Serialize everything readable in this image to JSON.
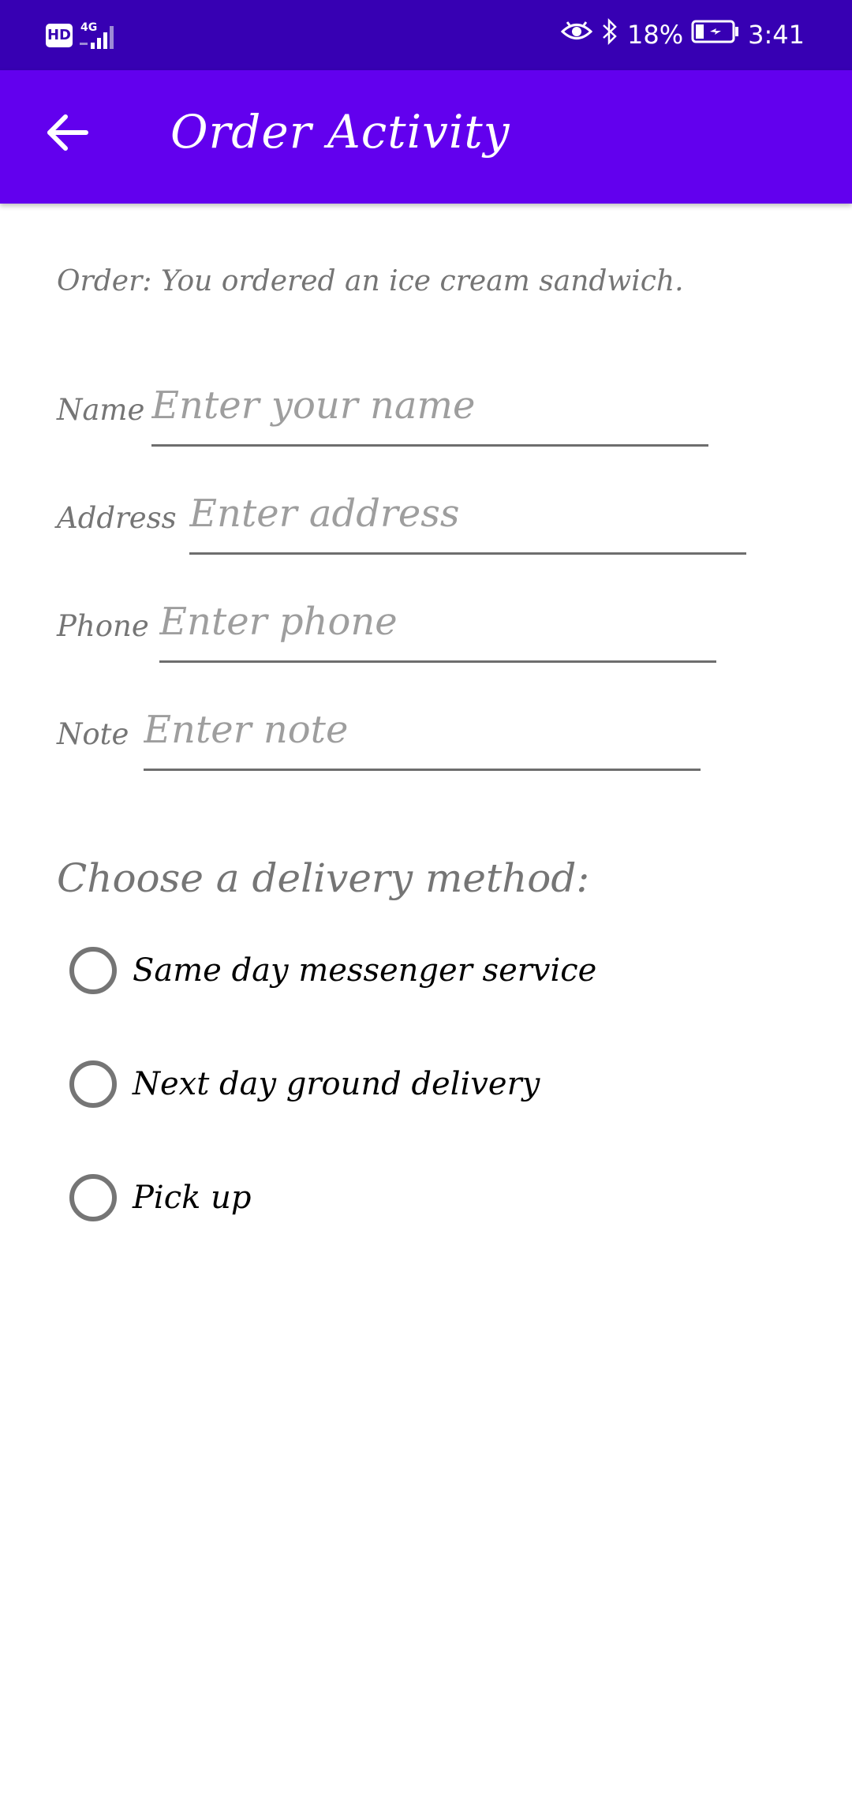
{
  "status_bar": {
    "hd": "HD",
    "network": "4G",
    "battery": "18%",
    "time": "3:41",
    "icons": [
      "hd-icon",
      "signal-icon",
      "eye-icon",
      "bluetooth-icon",
      "battery-icon"
    ]
  },
  "app_bar": {
    "title": "Order Activity",
    "back_icon": "arrow-back-icon",
    "color": "#6200ee",
    "status_color": "#3700b3"
  },
  "order": {
    "text": "Order: You ordered an ice cream sandwich."
  },
  "form": {
    "name_label": "Name",
    "name_placeholder": "Enter your name",
    "address_label": "Address",
    "address_placeholder": "Enter address",
    "phone_label": "Phone",
    "phone_placeholder": "Enter phone",
    "note_label": "Note",
    "note_placeholder": "Enter note"
  },
  "delivery": {
    "heading": "Choose a delivery method:",
    "options": [
      {
        "label": "Same day messenger service",
        "selected": false
      },
      {
        "label": "Next day ground delivery",
        "selected": false
      },
      {
        "label": "Pick up",
        "selected": false
      }
    ]
  }
}
